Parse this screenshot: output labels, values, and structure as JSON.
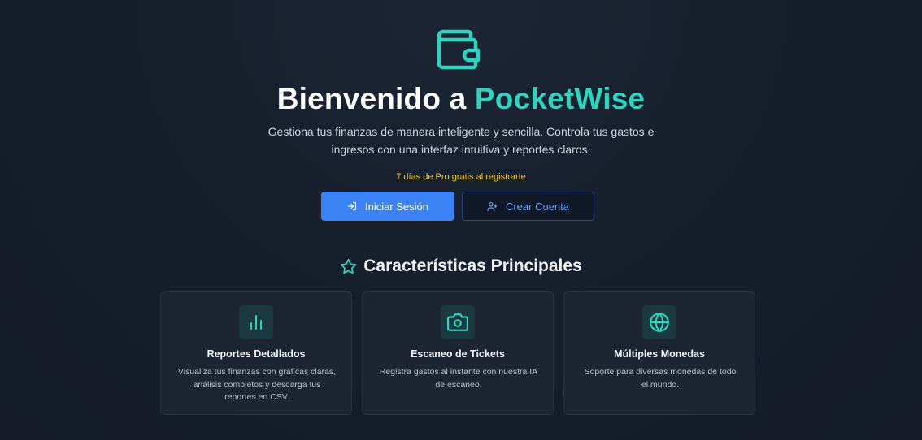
{
  "hero": {
    "logo_icon": "wallet-icon",
    "title_prefix": "Bienvenido a",
    "title_brand": "PocketWise",
    "subtitle": "Gestiona tus finanzas de manera inteligente y sencilla. Controla tus gastos e ingresos con una interfaz intuitiva y reportes claros.",
    "promo": "7 días de Pro gratis al registrarte"
  },
  "actions": {
    "login_label": "Iniciar Sesión",
    "login_icon": "log-in-icon",
    "signup_label": "Crear Cuenta",
    "signup_icon": "user-plus-icon"
  },
  "features": {
    "title": "Características Principales",
    "title_icon": "star-icon",
    "items": [
      {
        "icon": "bar-chart-icon",
        "title": "Reportes Detallados",
        "description": "Visualiza tus finanzas con gráficas claras, análisis completos y descarga tus reportes en CSV."
      },
      {
        "icon": "camera-icon",
        "title": "Escaneo de Tickets",
        "description": "Registra gastos al instante con nuestra IA de escaneo."
      },
      {
        "icon": "globe-icon",
        "title": "Múltiples Monedas",
        "description": "Soporte para diversas monedas de todo el mundo."
      }
    ]
  },
  "colors": {
    "background": "#161e2b",
    "brand_teal": "#2dd4bf",
    "primary_blue": "#3b82f6",
    "promo_yellow": "#facc15",
    "card_background": "#1d2533"
  }
}
